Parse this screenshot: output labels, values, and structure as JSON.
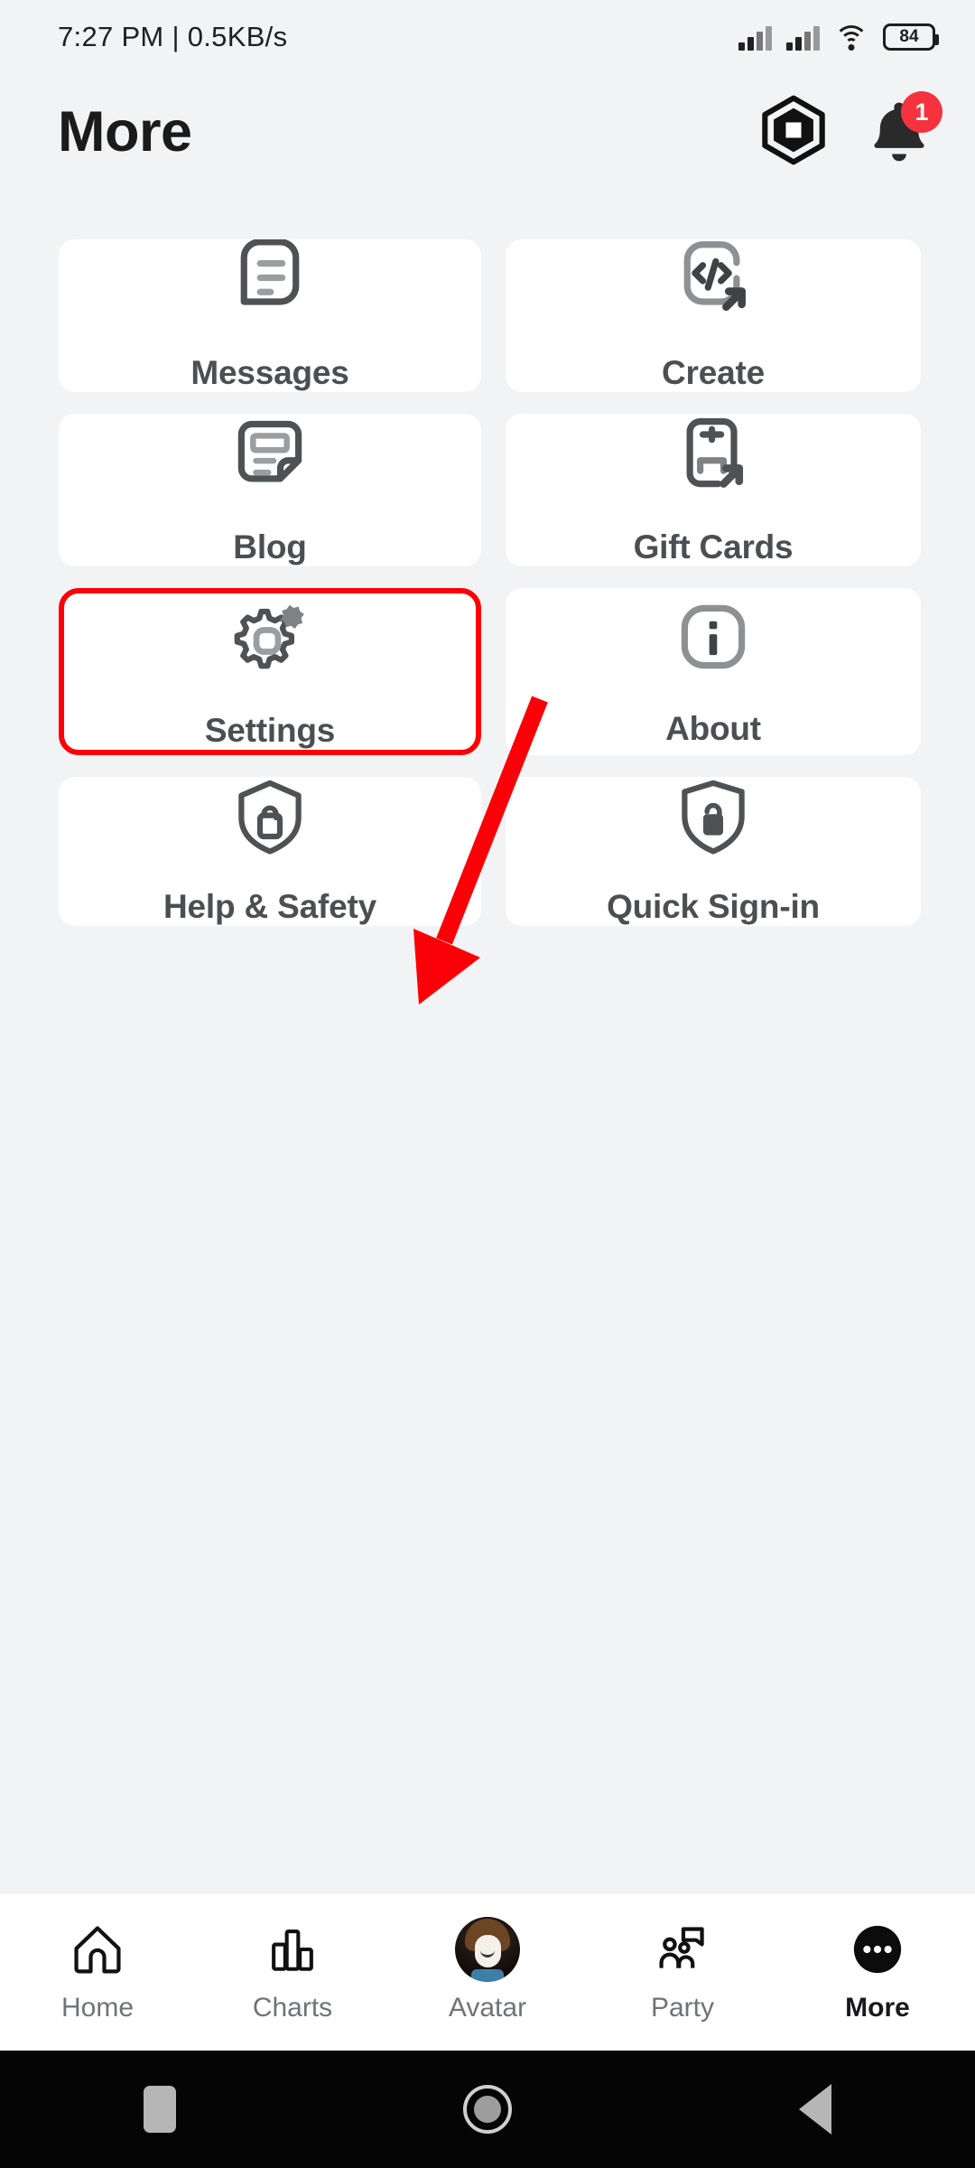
{
  "statusbar": {
    "time_and_network": "7:27 PM | 0.5KB/s",
    "signal_1_icon": "signal-bars-icon",
    "signal_2_icon": "signal-bars-icon",
    "wifi_icon": "wifi-icon",
    "battery_level": "84",
    "battery_icon": "battery-icon"
  },
  "header": {
    "title": "More",
    "robux_icon": "robux-hexagon-icon",
    "notifications_icon": "bell-icon",
    "notifications_badge": "1"
  },
  "grid": {
    "tiles": [
      {
        "label": "Messages",
        "icon": "chat-bubble-lines-icon"
      },
      {
        "label": "Create",
        "icon": "code-brackets-external-link-icon"
      },
      {
        "label": "Blog",
        "icon": "article-document-icon"
      },
      {
        "label": "Gift Cards",
        "icon": "gift-card-external-link-icon"
      },
      {
        "label": "Settings",
        "icon": "gears-icon"
      },
      {
        "label": "About",
        "icon": "info-rounded-square-icon"
      },
      {
        "label": "Help & Safety",
        "icon": "shield-lock-outline-icon"
      },
      {
        "label": "Quick Sign-in",
        "icon": "shield-lock-filled-icon"
      }
    ]
  },
  "annotation": {
    "highlight_color": "#fb0007",
    "arrow_color": "#fb0007",
    "highlighted_tile": "Settings",
    "arrow_icon": "pointer-arrow-icon"
  },
  "bottomnav": {
    "items": [
      {
        "label": "Home",
        "icon": "home-icon",
        "active": false
      },
      {
        "label": "Charts",
        "icon": "bar-chart-icon",
        "active": false
      },
      {
        "label": "Avatar",
        "icon": "avatar-icon",
        "active": false
      },
      {
        "label": "Party",
        "icon": "party-people-icon",
        "active": false
      },
      {
        "label": "More",
        "icon": "ellipsis-circle-icon",
        "active": true
      }
    ]
  },
  "sysnav": {
    "recents_icon": "recents-square-icon",
    "home_icon": "home-circle-icon",
    "back_icon": "back-triangle-icon"
  }
}
